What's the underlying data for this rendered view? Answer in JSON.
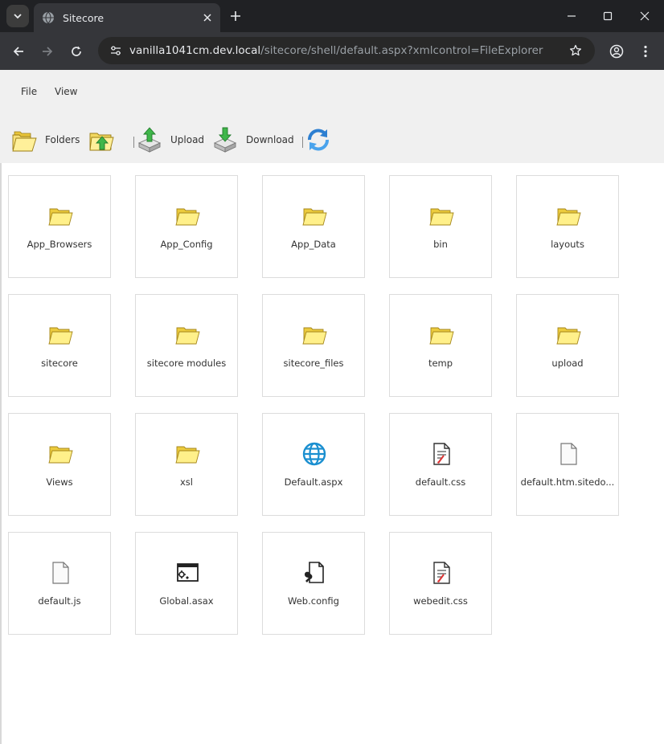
{
  "browser": {
    "tab_title": "Sitecore",
    "url_host": "vanilla1041cm.dev.local",
    "url_path": "/sitecore/shell/default.aspx?xmlcontrol=FileExplorer",
    "icons": [
      "chevron-down-icon",
      "globe-icon",
      "close-icon",
      "plus-icon",
      "minimize-icon",
      "maximize-icon",
      "back-icon",
      "forward-icon",
      "reload-icon",
      "tune-icon",
      "star-icon",
      "account-icon",
      "kebab-menu-icon"
    ]
  },
  "menu": {
    "file": "File",
    "view": "View"
  },
  "toolbar": {
    "folders": "Folders",
    "upload": "Upload",
    "download": "Download",
    "icons": [
      "folders-icon",
      "folder-up-icon",
      "upload-icon",
      "download-icon",
      "refresh-icon"
    ]
  },
  "files": [
    {
      "name": "App_Browsers",
      "icon": "folder-icon"
    },
    {
      "name": "App_Config",
      "icon": "folder-icon"
    },
    {
      "name": "App_Data",
      "icon": "folder-icon"
    },
    {
      "name": "bin",
      "icon": "folder-icon"
    },
    {
      "name": "layouts",
      "icon": "folder-icon"
    },
    {
      "name": "sitecore",
      "icon": "folder-icon"
    },
    {
      "name": "sitecore modules",
      "icon": "folder-icon"
    },
    {
      "name": "sitecore_files",
      "icon": "folder-icon"
    },
    {
      "name": "temp",
      "icon": "folder-icon"
    },
    {
      "name": "upload",
      "icon": "folder-icon"
    },
    {
      "name": "Views",
      "icon": "folder-icon"
    },
    {
      "name": "xsl",
      "icon": "folder-icon"
    },
    {
      "name": "Default.aspx",
      "icon": "globe-icon"
    },
    {
      "name": "default.css",
      "icon": "css-file-icon"
    },
    {
      "name": "default.htm.sitedo...",
      "icon": "blank-file-icon"
    },
    {
      "name": "default.js",
      "icon": "blank-file-icon"
    },
    {
      "name": "Global.asax",
      "icon": "window-settings-icon"
    },
    {
      "name": "Web.config",
      "icon": "config-file-icon"
    },
    {
      "name": "webedit.css",
      "icon": "css-file-icon"
    }
  ]
}
